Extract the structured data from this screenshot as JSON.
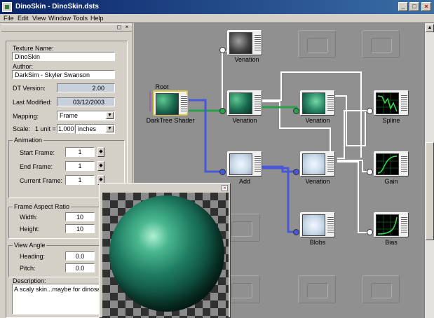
{
  "window": {
    "app_name": "DinoSkin",
    "document": "DinoSkin.dsts",
    "min_label": "_",
    "max_label": "□",
    "close_label": "×"
  },
  "menu": [
    "File",
    "Edit",
    "View",
    "Window",
    "Tools",
    "Help"
  ],
  "panel": {
    "close_label": "×",
    "texture_name_label": "Texture Name:",
    "texture_name": "DinoSkin",
    "author_label": "Author:",
    "author": "DarkSim - Skyler Swanson",
    "dt_version_label": "DT Version:",
    "dt_version": "2.00",
    "last_modified_label": "Last Modified:",
    "last_modified": "03/12/2003",
    "mapping_label": "Mapping:",
    "mapping": "Frame",
    "scale_label": "Scale:",
    "scale_unit_label": "1 unit =",
    "scale_value": "1.000",
    "scale_units": "inches",
    "animation": {
      "title": "Animation",
      "start_frame_label": "Start Frame:",
      "start_frame": "1",
      "end_frame_label": "End Frame:",
      "end_frame": "1",
      "current_frame_label": "Current Frame:",
      "current_frame": "1"
    },
    "aspect": {
      "title": "Frame Aspect Ratio",
      "width_label": "Width:",
      "width": "10",
      "height_label": "Height:",
      "height": "10"
    },
    "view_angle": {
      "title": "View Angle",
      "heading_label": "Heading:",
      "heading": "0.0",
      "pitch_label": "Pitch:",
      "pitch": "0.0"
    },
    "description_label": "Description:",
    "description": "A scaly skin...maybe for dinosaurs?"
  },
  "nodes": {
    "root_label": "Root",
    "dark_tree_shader": "DarkTree Shader",
    "venation_top": "Venation",
    "venation_mid": "Venation",
    "venation_right": "Venation",
    "spline": "Spline",
    "add": "Add",
    "venation_lower": "Venation",
    "gain": "Gain",
    "blobs": "Blobs",
    "bias": "Bias"
  },
  "preview": {
    "close_label": "×"
  },
  "colors": {
    "title_bar": "#0a246a",
    "canvas": "#909090",
    "link_green": "#2aa048",
    "link_blue": "#4858d8"
  }
}
